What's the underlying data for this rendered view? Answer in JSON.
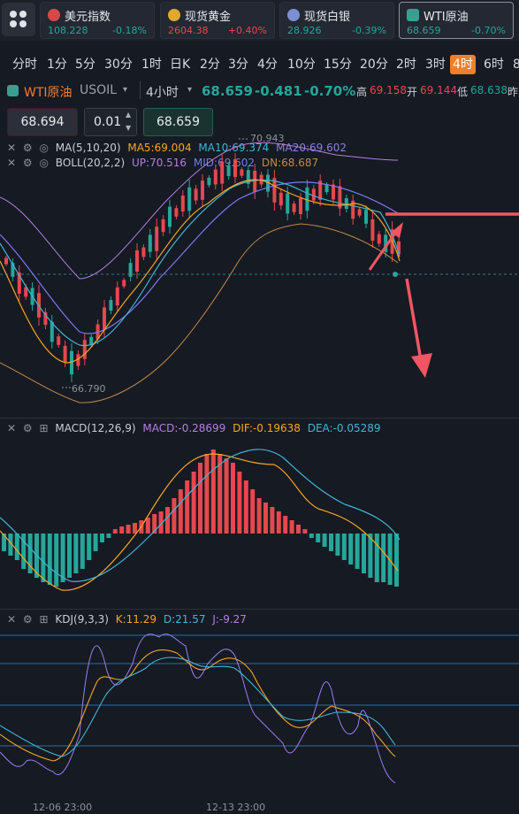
{
  "tickers": [
    {
      "name": "美元指数",
      "price": "108.228",
      "change": "-0.18%",
      "dir": "down",
      "flag_color": "#d94848"
    },
    {
      "name": "现货黄金",
      "price": "2604.38",
      "change": "+0.40%",
      "dir": "up",
      "flag_color": "#e0a82e"
    },
    {
      "name": "现货白银",
      "price": "28.926",
      "change": "-0.39%",
      "dir": "down",
      "flag_color": "#7d8fd4"
    },
    {
      "name": "WTI原油",
      "price": "68.659",
      "change": "-0.70%",
      "dir": "down",
      "flag_color": "#3a9f8f"
    }
  ],
  "timeframes": [
    "分时",
    "1分",
    "5分",
    "30分",
    "1时",
    "日K",
    "2分",
    "3分",
    "4分",
    "10分",
    "15分",
    "20分",
    "2时",
    "3时",
    "4时",
    "6时",
    "8"
  ],
  "active_timeframe": "4时",
  "instrument": {
    "name": "WTI原油",
    "code": "USOIL",
    "period": "4小时",
    "price": "68.659",
    "change": "-0.481",
    "change_pct": "-0.70%",
    "high_label": "高",
    "high": "69.158",
    "open_label": "开",
    "open": "69.144",
    "low_label": "低",
    "low": "68.638",
    "extra_label": "昨"
  },
  "order": {
    "sell_price": "68.694",
    "lot": "0.01",
    "buy_price": "68.659"
  },
  "indicators": {
    "ma": {
      "label": "MA(5,10,20)",
      "ma5": "MA5:69.004",
      "ma10": "MA10:69.374",
      "ma20": "MA20:69.602"
    },
    "boll": {
      "label": "BOLL(20,2,2)",
      "up": "UP:70.516",
      "mid": "MID:69.602",
      "dn": "DN:68.687"
    },
    "macd": {
      "label": "MACD(12,26,9)",
      "macd": "MACD:-0.28699",
      "dif": "DIF:-0.19638",
      "dea": "DEA:-0.05289"
    },
    "kdj": {
      "label": "KDJ(9,3,3)",
      "k": "K:11.29",
      "d": "D:21.57",
      "j": "J:-9.27"
    }
  },
  "chart_labels": {
    "high_marker": "70.943",
    "low_marker": "66.790"
  },
  "time_axis": [
    "12-06 23:00",
    "12-13 23:00"
  ],
  "colors": {
    "up": "#e5484d",
    "down": "#26a69a",
    "accent": "#f07f2b",
    "ma5": "#f5a623",
    "ma10": "#3fb6d8",
    "ma20": "#8c7fe0",
    "annotation": "#f25563"
  }
}
